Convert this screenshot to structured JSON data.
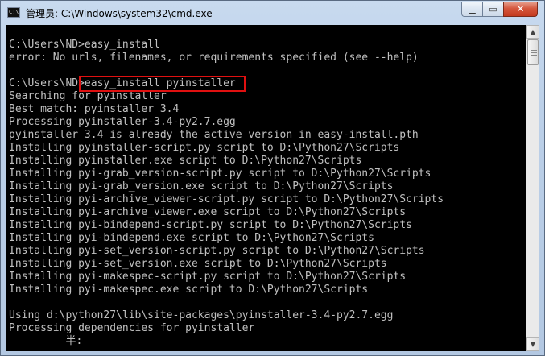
{
  "window": {
    "title": "管理员: C:\\Windows\\system32\\cmd.exe",
    "icon": "cmd-icon",
    "icon_text": "C:\\",
    "controls": {
      "minimize": "minimize-icon",
      "maximize": "maximize-icon",
      "close": "close-icon"
    },
    "control_glyphs": {
      "minimize": "▁",
      "maximize": "▭",
      "close": "✕"
    }
  },
  "console": {
    "highlighted_command": "easy_install pyinstaller",
    "lines": [
      "C:\\Users\\ND>easy_install",
      "error: No urls, filenames, or requirements specified (see --help)",
      "",
      "C:\\Users\\ND>easy_install pyinstaller",
      "Searching for pyinstaller",
      "Best match: pyinstaller 3.4",
      "Processing pyinstaller-3.4-py2.7.egg",
      "pyinstaller 3.4 is already the active version in easy-install.pth",
      "Installing pyinstaller-script.py script to D:\\Python27\\Scripts",
      "Installing pyinstaller.exe script to D:\\Python27\\Scripts",
      "Installing pyi-grab_version-script.py script to D:\\Python27\\Scripts",
      "Installing pyi-grab_version.exe script to D:\\Python27\\Scripts",
      "Installing pyi-archive_viewer-script.py script to D:\\Python27\\Scripts",
      "Installing pyi-archive_viewer.exe script to D:\\Python27\\Scripts",
      "Installing pyi-bindepend-script.py script to D:\\Python27\\Scripts",
      "Installing pyi-bindepend.exe script to D:\\Python27\\Scripts",
      "Installing pyi-set_version-script.py script to D:\\Python27\\Scripts",
      "Installing pyi-set_version.exe script to D:\\Python27\\Scripts",
      "Installing pyi-makespec-script.py script to D:\\Python27\\Scripts",
      "Installing pyi-makespec.exe script to D:\\Python27\\Scripts",
      "",
      "Using d:\\python27\\lib\\site-packages\\pyinstaller-3.4-py2.7.egg",
      "Processing dependencies for pyinstaller",
      "         半:"
    ]
  },
  "scrollbar": {
    "up_glyph": "▲",
    "down_glyph": "▼"
  },
  "colors": {
    "console_bg": "#000000",
    "console_fg": "#c0c0c0",
    "highlight_border": "#e01010",
    "close_button": "#c43a1f"
  }
}
